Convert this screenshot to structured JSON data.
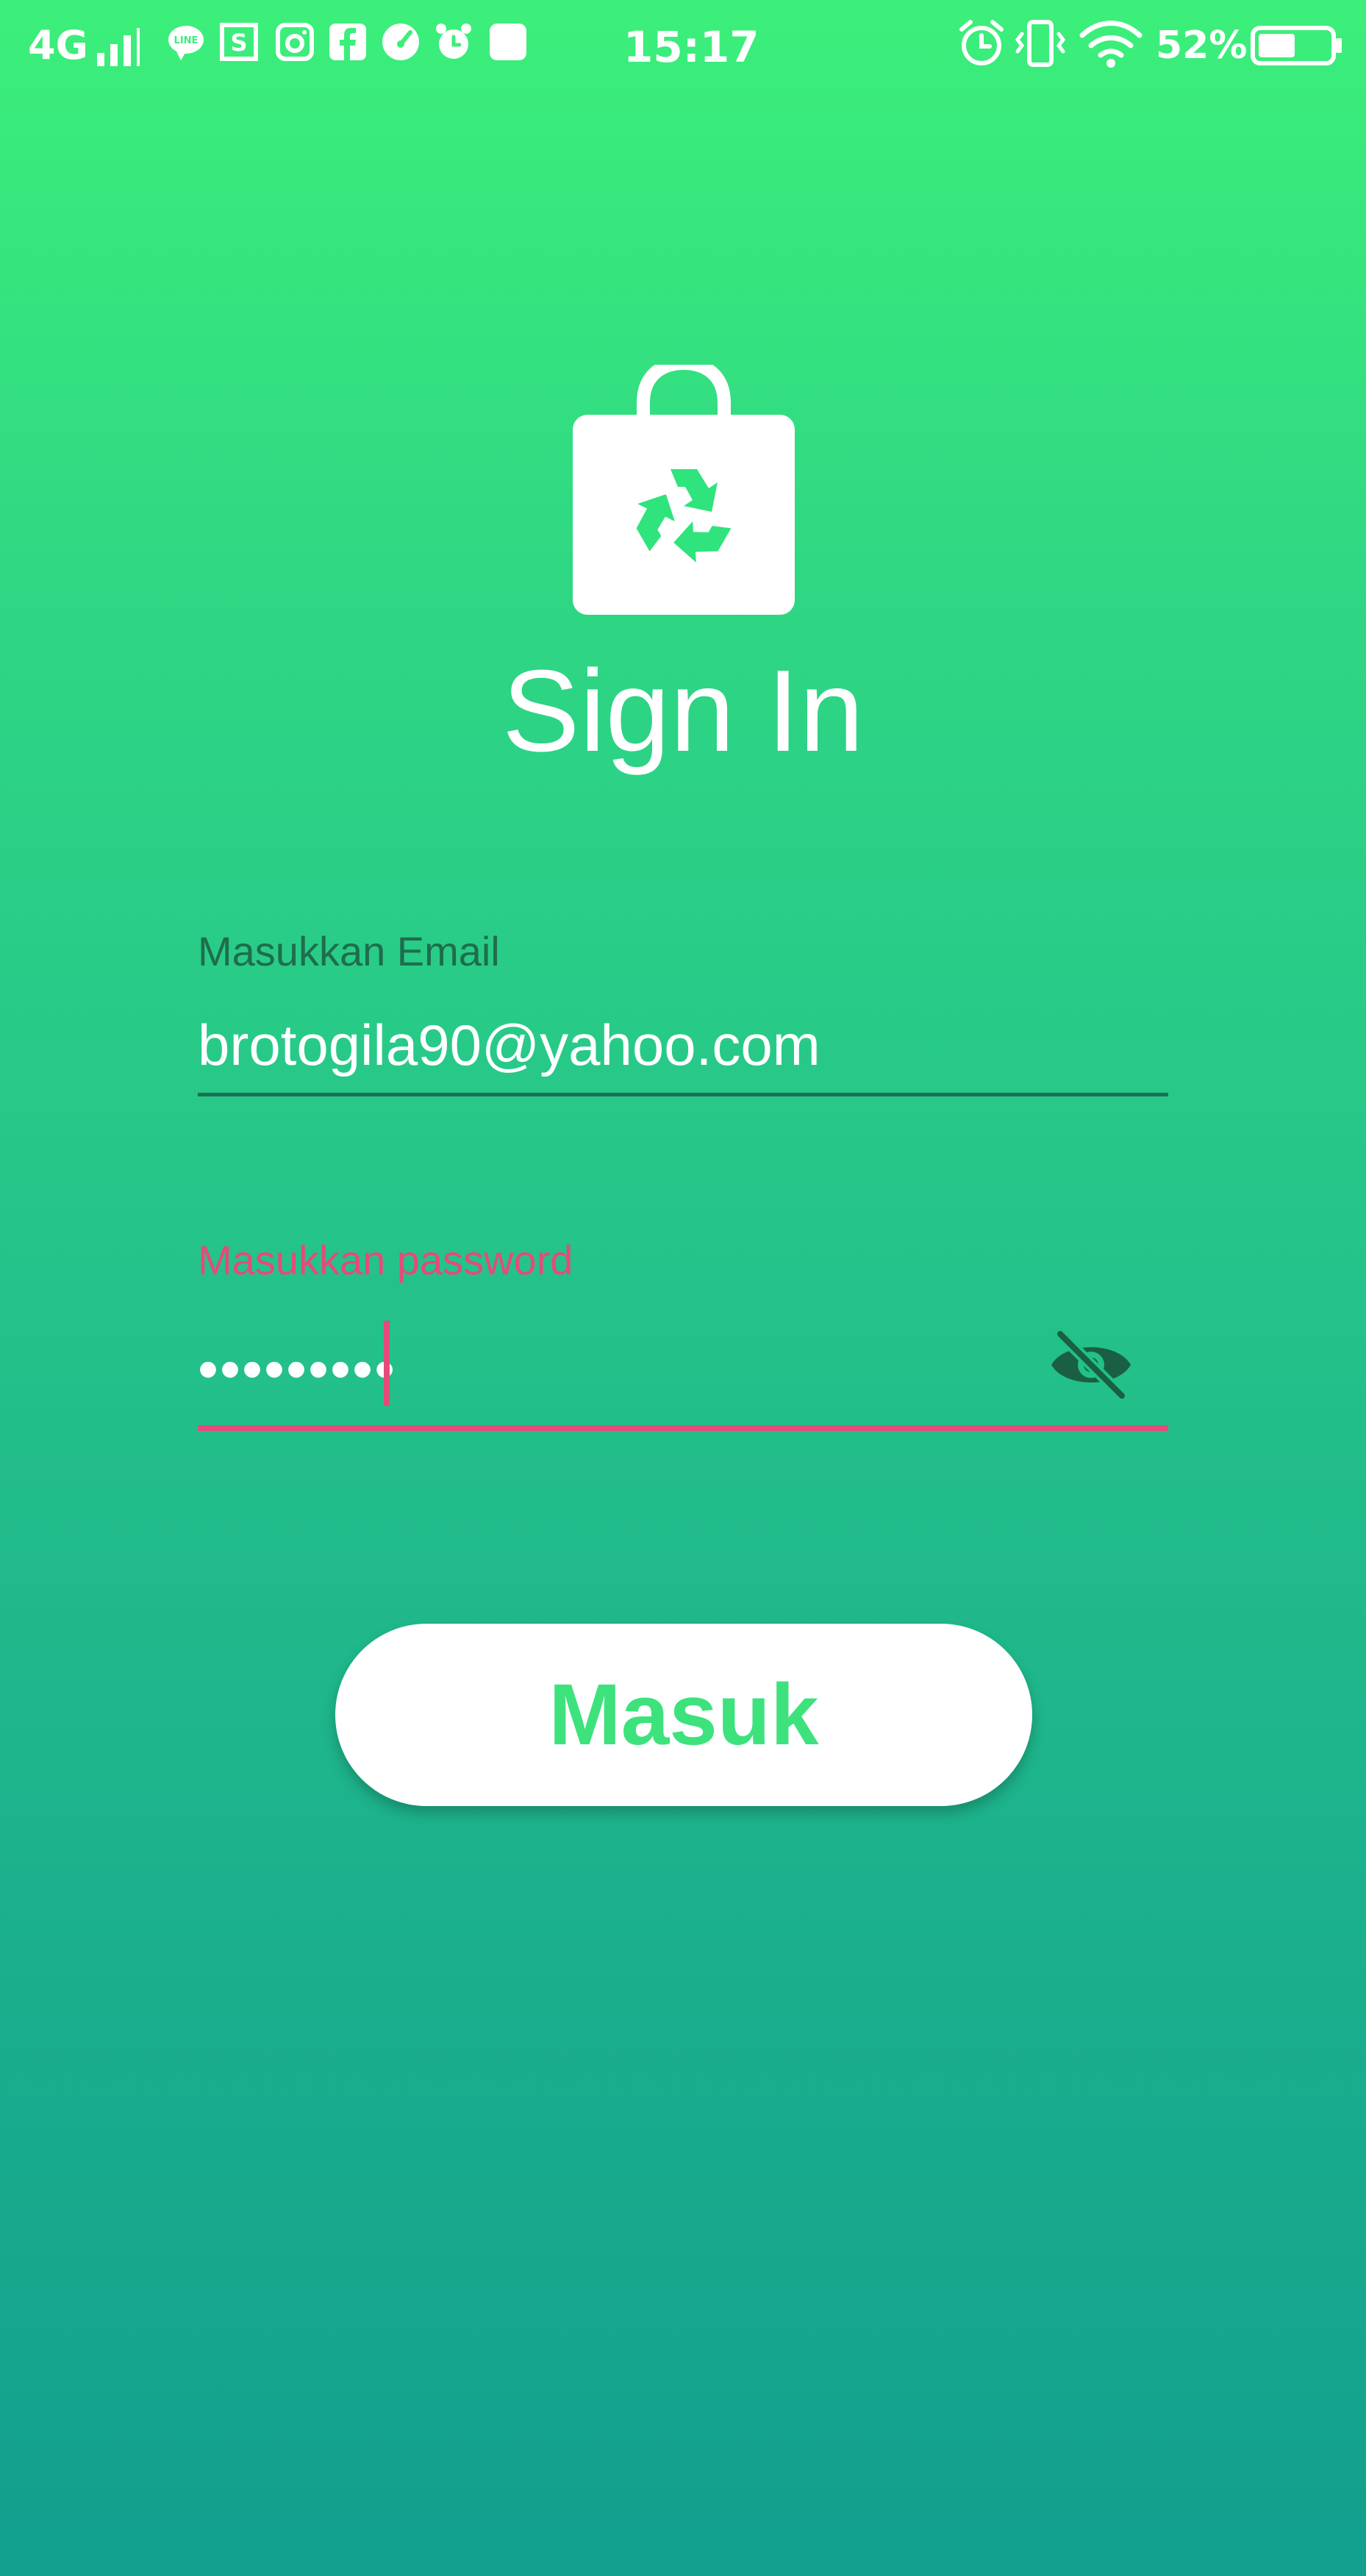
{
  "status_bar": {
    "network": "4G",
    "time": "15:17",
    "battery_percent": "52%",
    "battery_level": 0.52,
    "left_icons": [
      "signal-icon",
      "line-icon",
      "s-app-icon",
      "instagram-icon",
      "facebook-icon",
      "speedometer-icon",
      "alarm-icon",
      "square-app-icon"
    ],
    "right_icons": [
      "alarm-icon",
      "vibrate-icon",
      "wifi-icon",
      "battery-icon"
    ]
  },
  "logo": {
    "icon": "recycle-shopping-bag-icon"
  },
  "title": "Sign In",
  "form": {
    "email": {
      "label": "Masukkan Email",
      "value": "brotogila90@yahoo.com"
    },
    "password": {
      "label": "Masukkan password",
      "value": "•••••••••",
      "toggle_icon": "eye-off-icon"
    },
    "submit_label": "Masuk"
  },
  "colors": {
    "gradient_top": "#3cef7a",
    "gradient_bottom": "#129f8e",
    "accent_error": "#e54b7a",
    "button_text": "#3de27d",
    "email_label": "#1e6d4c"
  }
}
